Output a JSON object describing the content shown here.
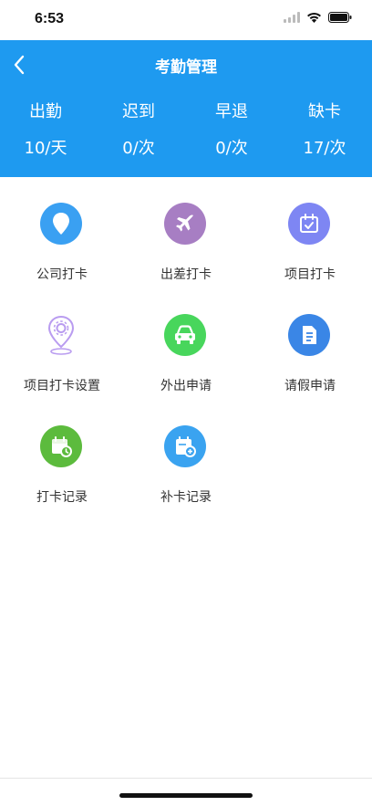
{
  "status_bar": {
    "time": "6:53"
  },
  "nav": {
    "title": "考勤管理"
  },
  "stats": [
    {
      "label": "出勤",
      "value": "10/天"
    },
    {
      "label": "迟到",
      "value": "0/次"
    },
    {
      "label": "早退",
      "value": "0/次"
    },
    {
      "label": "缺卡",
      "value": "17/次"
    }
  ],
  "menu": [
    {
      "label": "公司打卡",
      "icon": "location-pin-icon",
      "color": "#3aa0f2"
    },
    {
      "label": "出差打卡",
      "icon": "airplane-icon",
      "color": "#a77ec3"
    },
    {
      "label": "项目打卡",
      "icon": "calendar-check-icon",
      "color": "#7e86f3"
    },
    {
      "label": "项目打卡设置",
      "icon": "location-gear-icon",
      "color": "#b99cf0"
    },
    {
      "label": "外出申请",
      "icon": "car-icon",
      "color": "#48d65c"
    },
    {
      "label": "请假申请",
      "icon": "document-icon",
      "color": "#3a86e6"
    },
    {
      "label": "打卡记录",
      "icon": "calendar-clock-icon",
      "color": "#5cbb3d"
    },
    {
      "label": "补卡记录",
      "icon": "calendar-plus-icon",
      "color": "#3aa3f0"
    }
  ],
  "colors": {
    "header": "#1e9af0",
    "text": "#333333"
  }
}
